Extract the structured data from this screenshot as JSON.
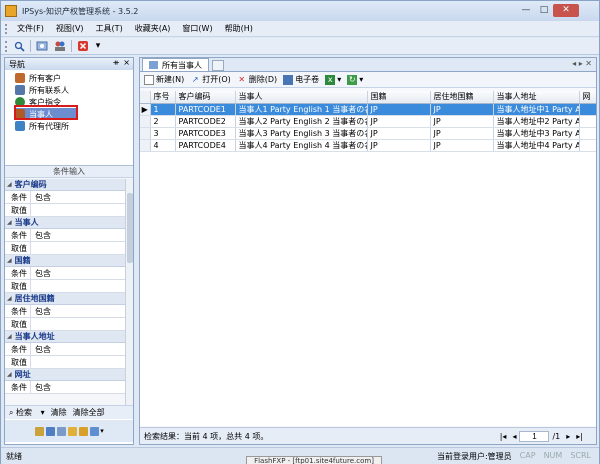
{
  "app": {
    "title": "IPSys-知识产权管理系统 - 3.5.2",
    "window_controls": [
      "—",
      "□",
      "✕"
    ]
  },
  "menu": [
    "文件(F)",
    "视图(V)",
    "工具(T)",
    "收藏夹(A)",
    "窗口(W)",
    "帮助(H)"
  ],
  "nav": {
    "title": "导航",
    "pin": "ᚑ",
    "close": "×",
    "items": [
      "所有客户",
      "所有联系人",
      "客户指令",
      "当事人",
      "所有代理所"
    ],
    "selected": "当事人"
  },
  "conditions": {
    "title": "条件输入",
    "groups": [
      {
        "name": "客户编码",
        "rows": [
          {
            "k": "条件",
            "v": "包含"
          },
          {
            "k": "取值",
            "v": ""
          }
        ]
      },
      {
        "name": "当事人",
        "rows": [
          {
            "k": "条件",
            "v": "包含"
          },
          {
            "k": "取值",
            "v": ""
          }
        ]
      },
      {
        "name": "国籍",
        "rows": [
          {
            "k": "条件",
            "v": "包含"
          },
          {
            "k": "取值",
            "v": ""
          }
        ]
      },
      {
        "name": "居住地国籍",
        "rows": [
          {
            "k": "条件",
            "v": "包含"
          },
          {
            "k": "取值",
            "v": ""
          }
        ]
      },
      {
        "name": "当事人地址",
        "rows": [
          {
            "k": "条件",
            "v": "包含"
          },
          {
            "k": "取值",
            "v": ""
          }
        ]
      },
      {
        "name": "网址",
        "rows": [
          {
            "k": "条件",
            "v": "包含"
          }
        ]
      }
    ],
    "footer": {
      "search": "检索",
      "clear": "清除",
      "clear_all": "清除全部"
    }
  },
  "tab": {
    "label": "所有当事人"
  },
  "doc_toolbar": {
    "new": "新建(N)",
    "open": "打开(O)",
    "delete": "删除(D)",
    "ebook": "电子卷"
  },
  "grid": {
    "columns": [
      "序号",
      "客户编码",
      "当事人",
      "国籍",
      "居住地国籍",
      "当事人地址",
      "网"
    ],
    "rows": [
      [
        "1",
        "PARTCODE1",
        "当事人1 Party English 1 当事者の名",
        "JP",
        "JP",
        "当事人地址中1 Party A"
      ],
      [
        "2",
        "PARTCODE2",
        "当事人2 Party English 2 当事者の名",
        "JP",
        "JP",
        "当事人地址中2 Party A"
      ],
      [
        "3",
        "PARTCODE3",
        "当事人3 Party English 3 当事者の名",
        "JP",
        "JP",
        "当事人地址中3 Party A"
      ],
      [
        "4",
        "PARTCODE4",
        "当事人4 Party English 4 当事者の名",
        "JP",
        "JP",
        "当事人地址中4 Party A"
      ]
    ],
    "selected_row": 0
  },
  "result": {
    "text": "检索结果：当前 4 项，总共 4 项。",
    "page": "1",
    "total": "/1"
  },
  "statusbar": {
    "left": "就绪",
    "user": "当前登录用户:管理员",
    "caps": "CAP",
    "num": "NUM",
    "scrl": "SCRL"
  },
  "tooltip": "FlashFXP - [ftp01.site4future.com]",
  "colors": {
    "selection": "#3b8bdc",
    "highlight_box": "#d81a1a"
  }
}
